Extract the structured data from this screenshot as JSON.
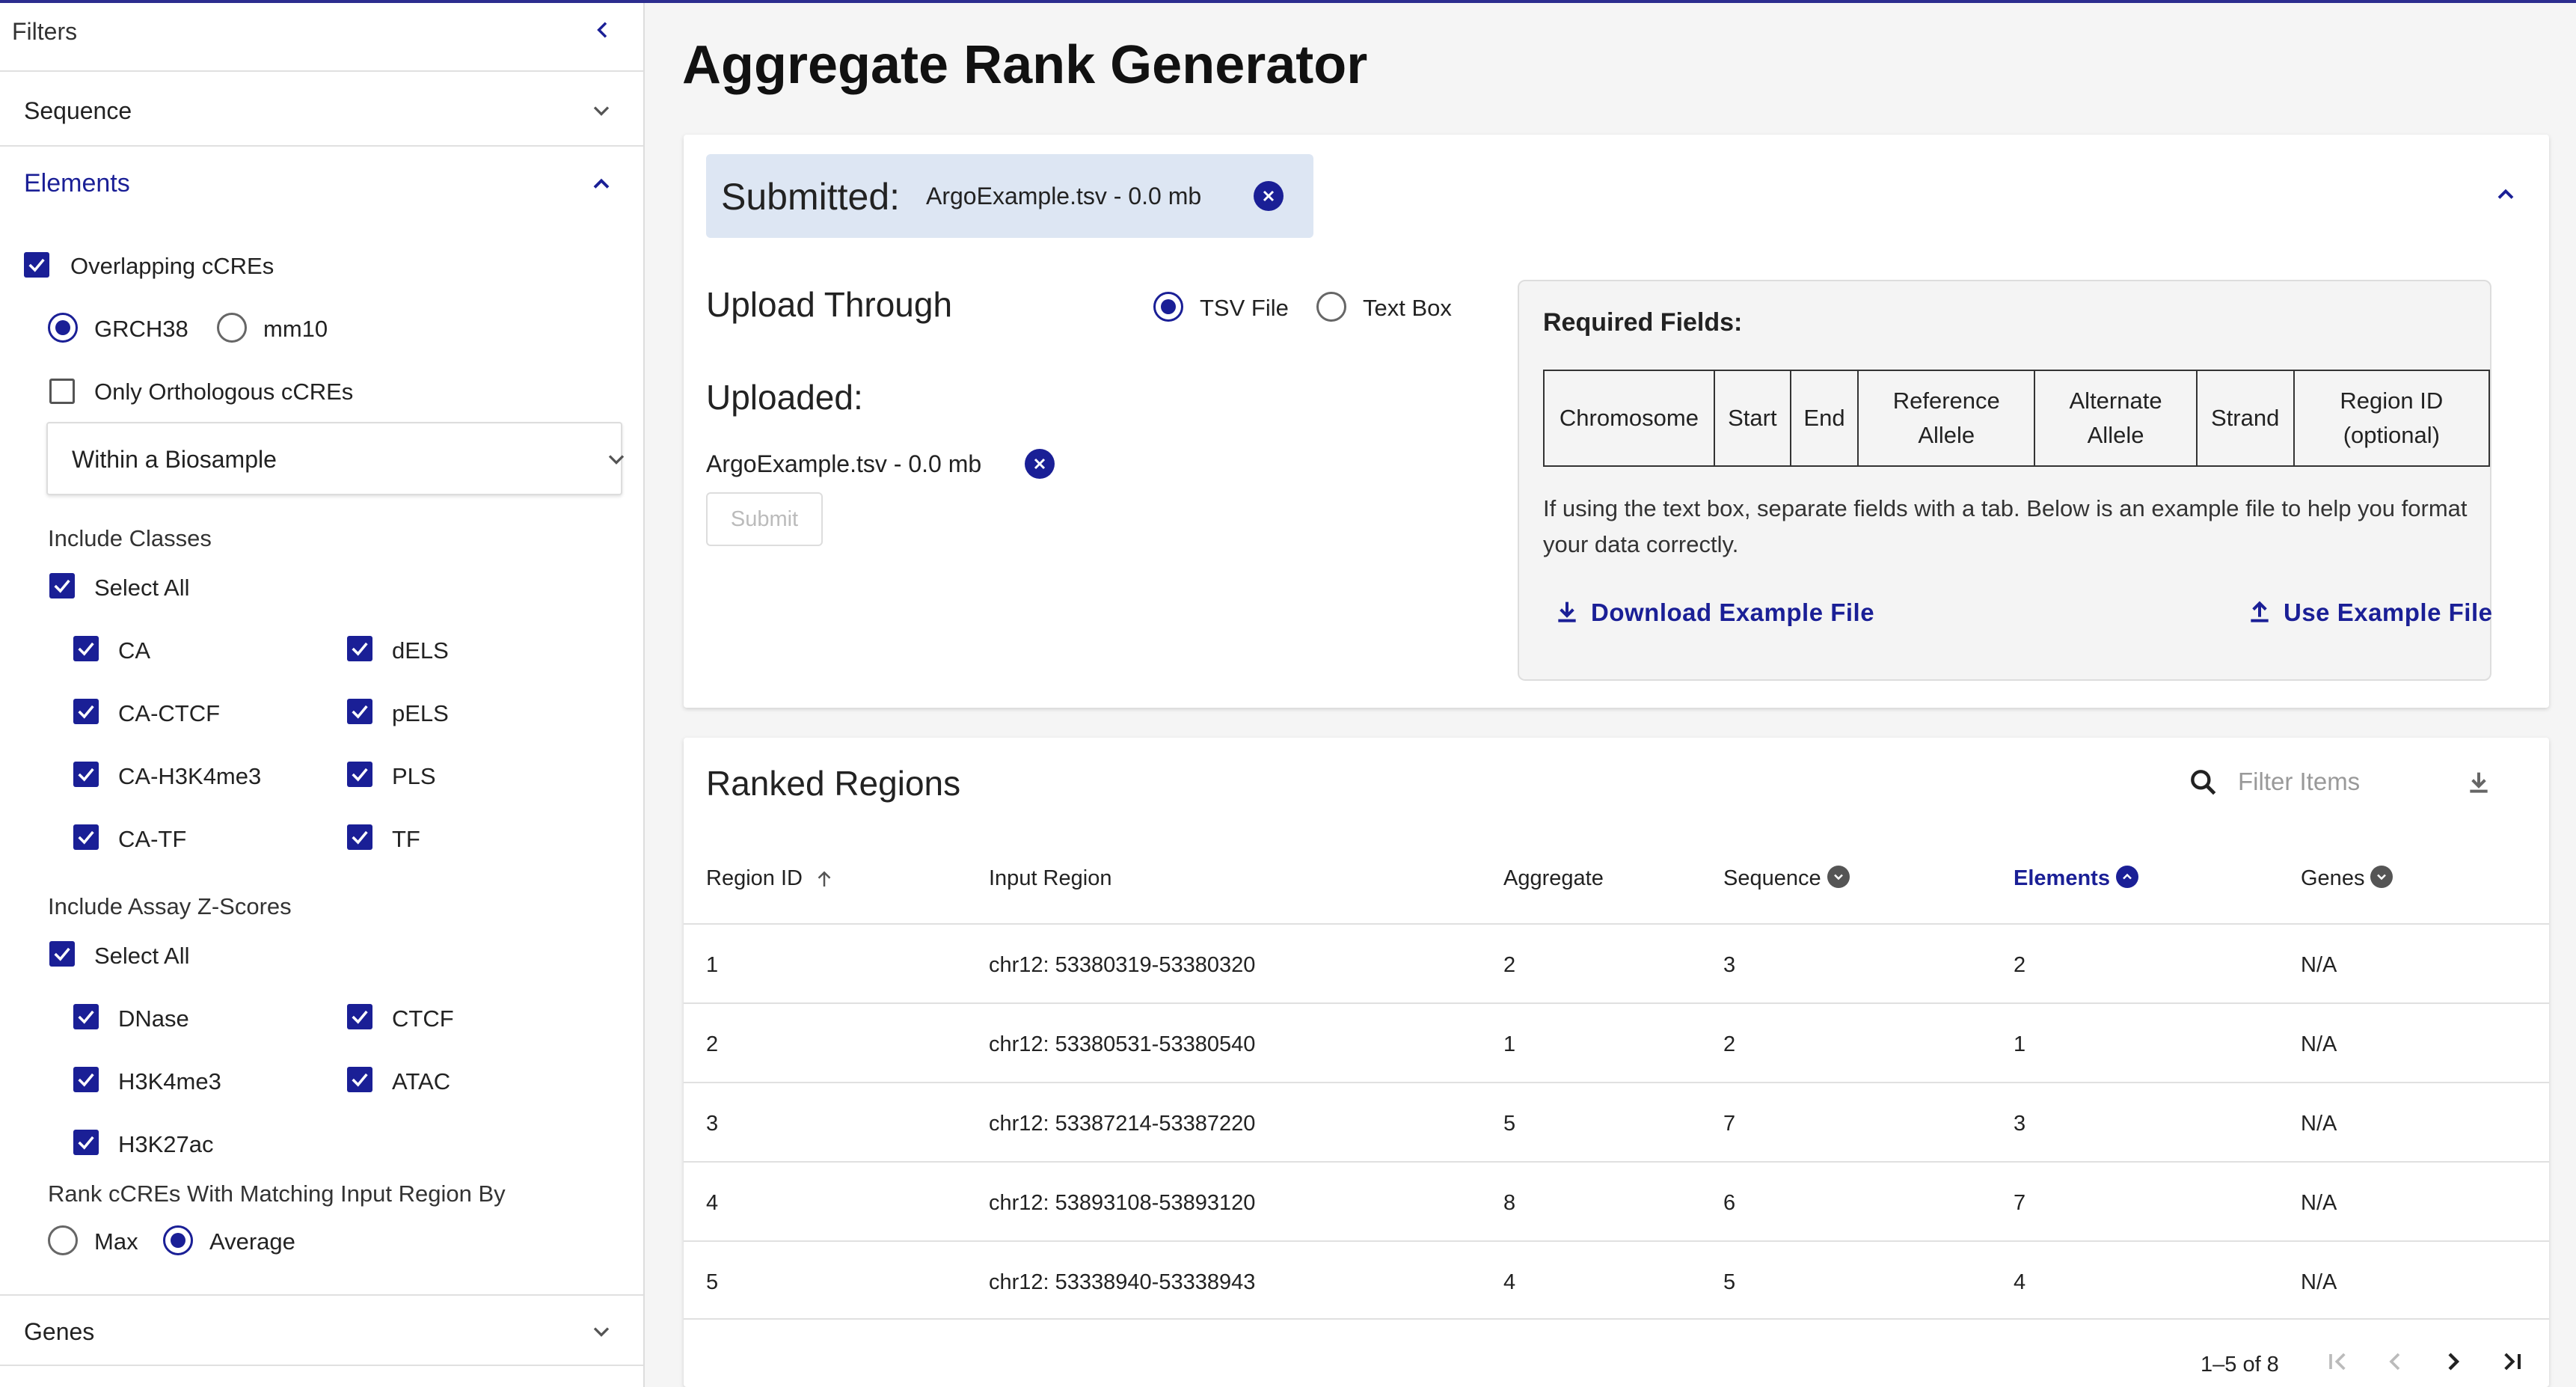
{
  "sidebar": {
    "title": "Filters",
    "sequence_label": "Sequence",
    "elements_label": "Elements",
    "overlapping_label": "Overlapping cCREs",
    "assembly_options": [
      "GRCH38",
      "mm10"
    ],
    "orthologous_label": "Only Orthologous cCREs",
    "biosample_select": "Within a Biosample",
    "include_classes_label": "Include Classes",
    "select_all_label": "Select All",
    "classes_col1": [
      "CA",
      "CA-CTCF",
      "CA-H3K4me3",
      "CA-TF"
    ],
    "classes_col2": [
      "dELS",
      "pELS",
      "PLS",
      "TF"
    ],
    "include_assays_label": "Include Assay Z-Scores",
    "assays_col1": [
      "DNase",
      "H3K4me3",
      "H3K27ac"
    ],
    "assays_col2": [
      "CTCF",
      "ATAC"
    ],
    "rank_label": "Rank cCREs With Matching Input Region By",
    "rank_options": [
      "Max",
      "Average"
    ],
    "genes_label": "Genes"
  },
  "page": {
    "title_parts": [
      {
        "t": "A",
        "b": true
      },
      {
        "t": "ggregate ",
        "b": false
      },
      {
        "t": "R",
        "b": true
      },
      {
        "t": "ank ",
        "b": false
      },
      {
        "t": "G",
        "b": true
      },
      {
        "t": "enerat",
        "b": false
      },
      {
        "t": "o",
        "b": true
      },
      {
        "t": "r",
        "b": false
      }
    ]
  },
  "upload": {
    "submitted_label": "Submitted:",
    "submitted_file": "ArgoExample.tsv - 0.0 mb",
    "upload_through_label": "Upload Through",
    "method_options": [
      "TSV File",
      "Text Box"
    ],
    "uploaded_label": "Uploaded:",
    "uploaded_file": "ArgoExample.tsv - 0.0 mb",
    "submit_label": "Submit",
    "required_title": "Required Fields:",
    "fields": [
      "Chromosome",
      "Start",
      "End",
      "Reference Allele",
      "Alternate Allele",
      "Strand",
      "Region ID (optional)"
    ],
    "description": "If using the text box, separate fields with a tab. Below is an example file to help you format your data correctly.",
    "download_label": "Download Example File",
    "use_example_label": "Use Example File"
  },
  "ranked": {
    "title": "Ranked Regions",
    "filter_placeholder": "Filter Items",
    "columns": [
      "Region ID",
      "Input Region",
      "Aggregate",
      "Sequence",
      "Elements",
      "Genes"
    ],
    "rows": [
      [
        "1",
        "chr12: 53380319-53380320",
        "2",
        "3",
        "2",
        "N/A"
      ],
      [
        "2",
        "chr12: 53380531-53380540",
        "1",
        "2",
        "1",
        "N/A"
      ],
      [
        "3",
        "chr12: 53387214-53387220",
        "5",
        "7",
        "3",
        "N/A"
      ],
      [
        "4",
        "chr12: 53893108-53893120",
        "8",
        "6",
        "7",
        "N/A"
      ],
      [
        "5",
        "chr12: 53338940-53338943",
        "4",
        "5",
        "4",
        "N/A"
      ]
    ],
    "pagination": "1–5 of 8"
  },
  "colors": {
    "accent": "#1a1f96",
    "submitted_bg": "#dde6f3"
  }
}
